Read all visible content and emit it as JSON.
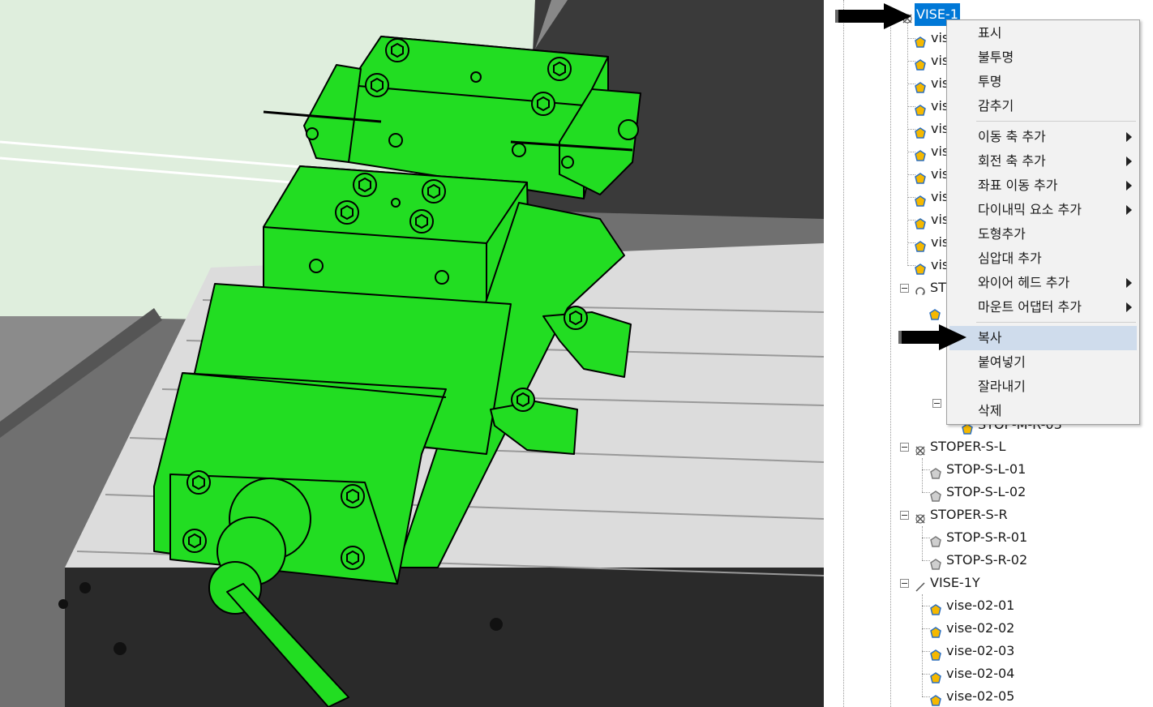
{
  "tree": {
    "root_label": "VISE-1",
    "truncated_item_label": "vis",
    "group_st_label": "ST",
    "hidden_item_label": "STOP-M-R-03",
    "groups": [
      {
        "label": "STOPER-S-L",
        "children": [
          "STOP-S-L-01",
          "STOP-S-L-02"
        ]
      },
      {
        "label": "STOPER-S-R",
        "children": [
          "STOP-S-R-01",
          "STOP-S-R-02"
        ]
      },
      {
        "label": "VISE-1Y",
        "children": [
          "vise-02-01",
          "vise-02-02",
          "vise-02-03",
          "vise-02-04",
          "vise-02-05"
        ]
      }
    ]
  },
  "context_menu": {
    "items": [
      {
        "label": "표시",
        "submenu": false
      },
      {
        "label": "불투명",
        "submenu": false
      },
      {
        "label": "투명",
        "submenu": false
      },
      {
        "label": "감추기",
        "submenu": false
      },
      {
        "label": "이동 축 추가",
        "submenu": true
      },
      {
        "label": "회전 축 추가",
        "submenu": true
      },
      {
        "label": "좌표 이동 추가",
        "submenu": true
      },
      {
        "label": "다이내믹 요소 추가",
        "submenu": true
      },
      {
        "label": "도형추가",
        "submenu": false
      },
      {
        "label": "심압대 추가",
        "submenu": false
      },
      {
        "label": "와이어 헤드 추가",
        "submenu": true
      },
      {
        "label": "마운트 어댑터 추가",
        "submenu": true
      },
      {
        "label": "복사",
        "submenu": false,
        "highlighted": true
      },
      {
        "label": "붙여넣기",
        "submenu": false
      },
      {
        "label": "잘라내기",
        "submenu": false
      },
      {
        "label": "삭제",
        "submenu": false
      }
    ]
  },
  "colors": {
    "model_green": "#22dd22",
    "selection_blue": "#0078d7",
    "menu_highlight": "#cfdcec"
  }
}
